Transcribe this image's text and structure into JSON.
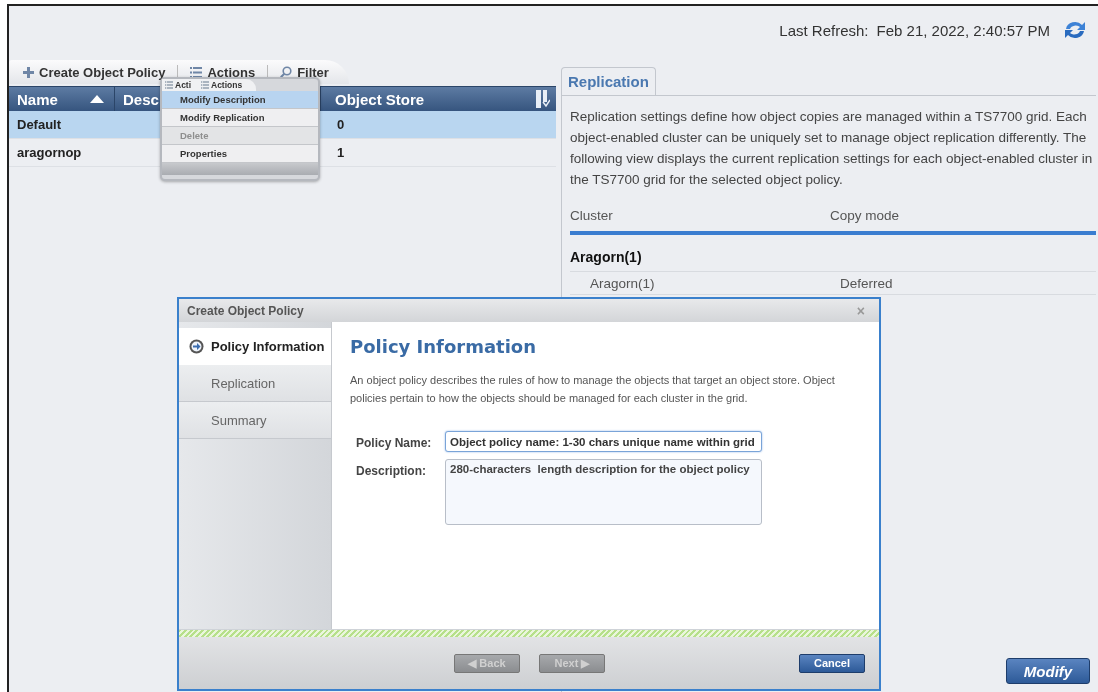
{
  "header": {
    "last_refresh_label": "Last Refresh:",
    "last_refresh_value": "Feb 21, 2022, 2:40:57 PM"
  },
  "toolbar": {
    "items": [
      {
        "kind": "create",
        "label": "Create Object Policy"
      },
      {
        "kind": "actions",
        "label": "Actions"
      },
      {
        "kind": "filter",
        "label": "Filter"
      }
    ]
  },
  "table": {
    "columns": [
      {
        "label": "Name",
        "sorted": true
      },
      {
        "label": "Desc",
        "sorted": false
      },
      {
        "label": "Object Store",
        "sorted": false
      }
    ],
    "rows": [
      {
        "name": "Default",
        "object_store": "0",
        "selected": true
      },
      {
        "name": "aragornop",
        "object_store": "1",
        "selected": false
      }
    ]
  },
  "actions_menu": {
    "tabs": [
      "Acti",
      "Actions"
    ],
    "items": [
      {
        "label": "Modify Description",
        "highlighted": true,
        "disabled": false
      },
      {
        "label": "Modify Replication",
        "highlighted": false,
        "disabled": false
      },
      {
        "label": "Delete",
        "highlighted": false,
        "disabled": true
      },
      {
        "label": "Properties",
        "highlighted": false,
        "disabled": false
      }
    ]
  },
  "details": {
    "tabs": [
      {
        "label": "Replication",
        "selected": true
      }
    ],
    "description": "Replication settings define how object copies are managed within a TS7700 grid. Each object-enabled cluster can be uniquely set to manage object replication differently. The following view displays the current replication settings for each object-enabled cluster in the TS7700 grid for the selected object policy.",
    "columns": [
      "Cluster",
      "Copy mode"
    ],
    "groups": [
      {
        "title": "Aragorn(1)",
        "rows": [
          {
            "cluster": "Aragorn(1)",
            "copy_mode": "Deferred"
          }
        ]
      }
    ]
  },
  "modify_button": "Modify",
  "dialog": {
    "title": "Create Object Policy",
    "close": "×",
    "steps": [
      {
        "label": "Policy Information",
        "selected": true
      },
      {
        "label": "Replication",
        "selected": false
      },
      {
        "label": "Summary",
        "selected": false
      }
    ],
    "heading": "Policy Information",
    "intro": "An object policy describes the rules of how to manage the objects that target an object store. Object policies pertain to how the objects should be managed for each cluster in the grid.",
    "fields": [
      {
        "kind": "text",
        "label": "Policy Name:",
        "value": "Object policy name: 1-30 chars unique name within grid",
        "focused": true
      },
      {
        "kind": "textarea",
        "label": "Description:",
        "value": "280-characters  length description for the object policy",
        "focused": false
      }
    ],
    "buttons": [
      {
        "kind": "back",
        "label": "◀ Back",
        "disabled": true
      },
      {
        "kind": "next",
        "label": "Next ▶",
        "disabled": true
      },
      {
        "kind": "cancel",
        "label": "Cancel",
        "disabled": false
      }
    ]
  }
}
